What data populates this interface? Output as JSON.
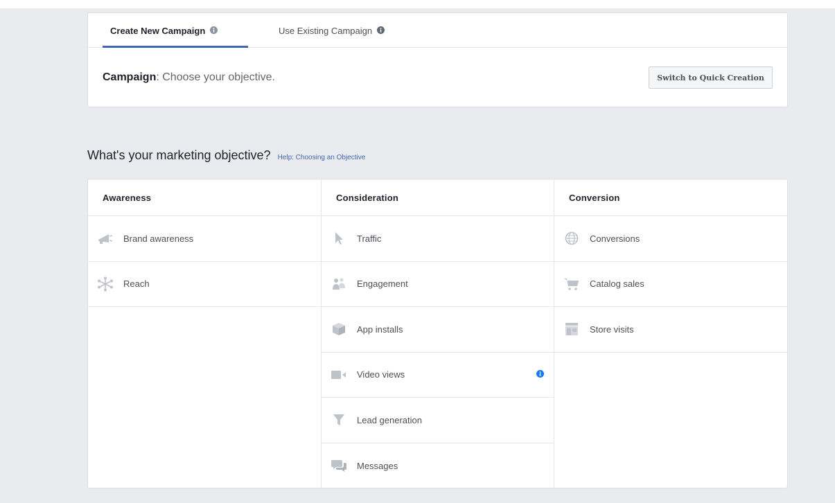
{
  "tabs": [
    {
      "label": "Create New Campaign",
      "active": true
    },
    {
      "label": "Use Existing Campaign",
      "active": false
    }
  ],
  "campaign": {
    "label": "Campaign",
    "text": ": Choose your objective.",
    "quick_button": "Switch to Quick Creation"
  },
  "objective": {
    "question": "What's your marketing objective?",
    "help_link": "Help: Choosing an Objective"
  },
  "columns": [
    {
      "title": "Awareness",
      "items": [
        {
          "label": "Brand awareness",
          "icon": "megaphone-icon"
        },
        {
          "label": "Reach",
          "icon": "reach-icon"
        }
      ]
    },
    {
      "title": "Consideration",
      "items": [
        {
          "label": "Traffic",
          "icon": "cursor-icon"
        },
        {
          "label": "Engagement",
          "icon": "people-icon"
        },
        {
          "label": "App installs",
          "icon": "box-icon"
        },
        {
          "label": "Video views",
          "icon": "video-camera-icon"
        },
        {
          "label": "Lead generation",
          "icon": "funnel-icon"
        },
        {
          "label": "Messages",
          "icon": "chat-bubbles-icon"
        }
      ]
    },
    {
      "title": "Conversion",
      "items": [
        {
          "label": "Conversions",
          "icon": "globe-icon"
        },
        {
          "label": "Catalog sales",
          "icon": "cart-icon"
        },
        {
          "label": "Store visits",
          "icon": "store-icon"
        }
      ]
    }
  ],
  "colors": {
    "accent": "#4267b2",
    "info_blue": "#1877f2",
    "icon_gray": "#bec3c9",
    "background": "#e9ebee"
  }
}
